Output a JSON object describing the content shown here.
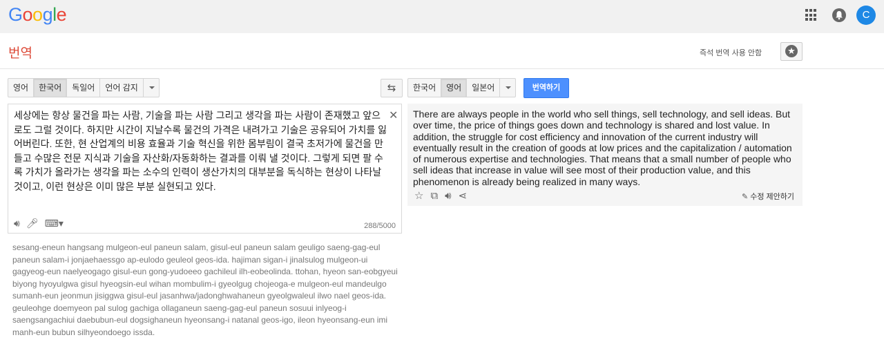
{
  "header": {
    "logo_letters": [
      {
        "char": "G",
        "color": "#4285f4"
      },
      {
        "char": "o",
        "color": "#ea4335"
      },
      {
        "char": "o",
        "color": "#fbbc05"
      },
      {
        "char": "g",
        "color": "#4285f4"
      },
      {
        "char": "l",
        "color": "#34a853"
      },
      {
        "char": "e",
        "color": "#ea4335"
      }
    ],
    "avatar_letter": "C",
    "avatar_color": "#1e88e5"
  },
  "page": {
    "title": "번역",
    "instant_link": "즉석 번역 사용 안함"
  },
  "source_langs": [
    "영어",
    "한국어",
    "독일어",
    "언어 감지"
  ],
  "source_active": 1,
  "target_langs": [
    "한국어",
    "영어",
    "일본어"
  ],
  "target_active": 1,
  "translate_button": "번역하기",
  "source": {
    "text": "세상에는 항상 물건을 파는 사람, 기술을 파는 사람 그리고 생각을 파는 사람이 존재했고 앞으로도 그럴 것이다. 하지만 시간이 지날수록 물건의 가격은 내려가고 기술은 공유되어 가치를 잃어버린다. 또한, 현 산업계의 비용 효율과 기술 혁신을 위한 몸부림이 결국 초저가에 물건을 만들고 수많은 전문 지식과 기술을 자산화/자동화하는 결과를 이뤄 낼 것이다. 그렇게 되면 팔 수록 가치가 올라가는 생각을 파는 소수의 인력이 생산가치의 대부분을 독식하는 현상이 나타날 것이고, 이런 현상은 이미 많은 부분 실현되고 있다.",
    "char_count": "288/5000"
  },
  "romanization": "sesang-eneun hangsang mulgeon-eul paneun salam, gisul-eul paneun salam geuligo saeng-gag-eul paneun salam-i jonjaehaessgo ap-eulodo geuleol geos-ida. hajiman sigan-i jinalsulog mulgeon-ui gagyeog-eun naelyeogago gisul-eun gong-yudoeeo gachileul ilh-eobeolinda. ttohan, hyeon san-eobgyeui biyong hyoyulgwa gisul hyeogsin-eul wihan mombulim-i gyeolgug chojeoga-e mulgeon-eul mandeulgo sumanh-eun jeonmun jisiggwa gisul-eul jasanhwa/jadonghwahaneun gyeolgwaleul ilwo nael geos-ida. geuleohge doemyeon pal sulog gachiga ollaganeun saeng-gag-eul paneun sosuui inlyeog-i saengsangachiui daebubun-eul dogsighaneun hyeonsang-i natanal geos-igo, ileon hyeonsang-eun imi manh-eun bubun silhyeondoego issda.",
  "target": {
    "text": "There are always people in the world who sell things, sell technology, and sell ideas. But over time, the price of things goes down and technology is shared and lost value. In addition, the struggle for cost efficiency and innovation of the current industry will eventually result in the creation of goods at low prices and the capitalization / automation of numerous expertise and technologies. That means that a small number of people who sell ideas that increase in value will see most of their production value, and this phenomenon is already being realized in many ways.",
    "suggest_edit": "수정 제안하기"
  },
  "colors": {
    "title_red": "#dd4b39",
    "button_blue": "#4d90fe"
  }
}
